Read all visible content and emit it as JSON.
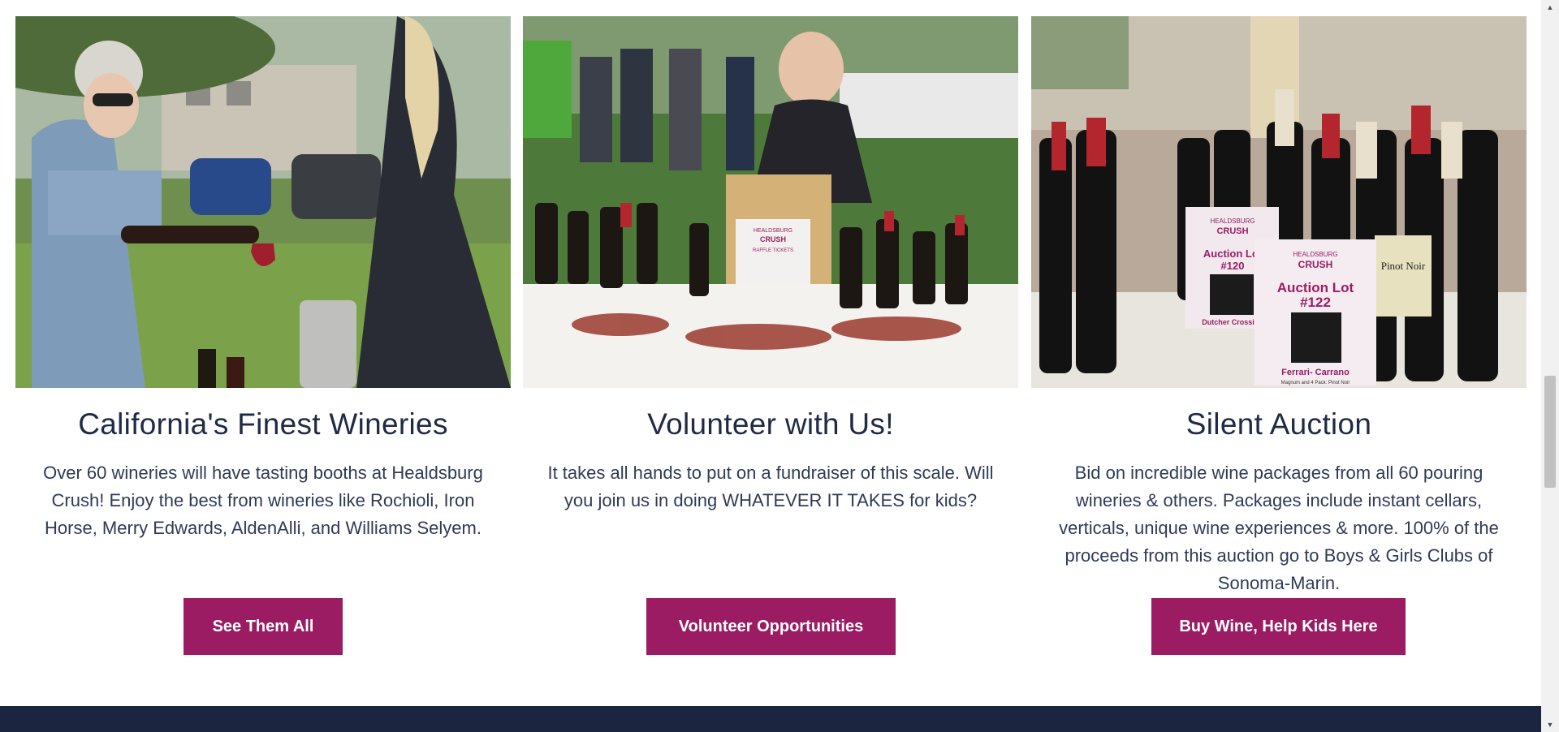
{
  "cards": [
    {
      "photo_alt": "Woman pouring wine",
      "title": "California's Finest Wineries",
      "description": "Over 60 wineries will have tasting booths at Healdsburg Crush! Enjoy the best from wineries like Rochioli, Iron Horse, Merry Edwards, AldenAlli, and Williams Selyem.",
      "button_label": "See Them All"
    },
    {
      "photo_alt": "Volunteer at raffle table",
      "title": "Volunteer with Us!",
      "description": "It takes all hands to put on a fundraiser of this scale. Will you join us in doing WHATEVER IT TAKES for kids?",
      "button_label": "Volunteer Opportunities"
    },
    {
      "photo_alt": "Auction wine bottles",
      "title": "Silent Auction",
      "description": "Bid on incredible wine packages from all 60 pouring wineries & others. Packages include instant cellars, verticals, unique wine experiences & more. 100% of the proceeds from this auction go to Boys & Girls Clubs of Sonoma-Marin.",
      "button_label": "Buy Wine, Help Kids Here"
    }
  ],
  "photo_text": {
    "sign_brand": "HEALDSBURG",
    "sign_name": "CRUSH",
    "raffle": "RAFFLE TICKETS",
    "lot_120_title": "Auction Lot",
    "lot_120_num": "#120",
    "lot_120_winery": "Dutcher Crossing",
    "lot_122_title": "Auction Lot",
    "lot_122_num": "#122",
    "lot_122_winery": "Ferrari- Carrano",
    "lot_122_note": "Magnum and 4 Pack: Pinot Noir",
    "bottle_label": "Pinot Noir"
  },
  "colors": {
    "accent": "#9b1c62",
    "heading": "#1f2a44",
    "footer": "#1c2540"
  },
  "scrollbar": {
    "up_icon": "▲",
    "down_icon": "▼"
  }
}
